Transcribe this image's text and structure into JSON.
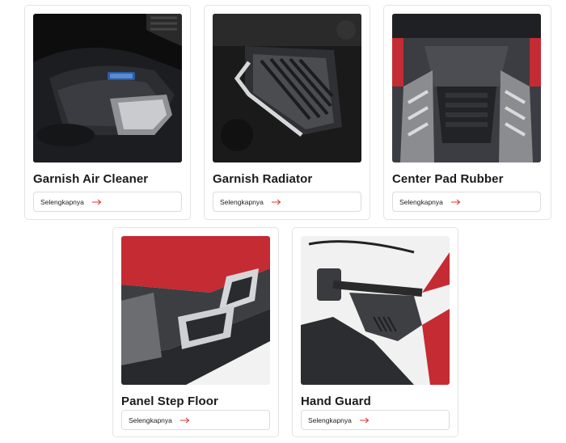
{
  "accent_color": "#d23a3a",
  "products": [
    {
      "title": "Garnish Air Cleaner",
      "link_label": "Selengkapnya",
      "image": "air-cleaner-garnish-photo"
    },
    {
      "title": "Garnish Radiator",
      "link_label": "Selengkapnya",
      "image": "radiator-garnish-photo"
    },
    {
      "title": "Center Pad Rubber",
      "link_label": "Selengkapnya",
      "image": "center-pad-rubber-photo"
    },
    {
      "title": "Panel Step Floor",
      "link_label": "Selengkapnya",
      "image": "panel-step-floor-photo"
    },
    {
      "title": "Hand Guard",
      "link_label": "Selengkapnya",
      "image": "hand-guard-photo"
    }
  ]
}
